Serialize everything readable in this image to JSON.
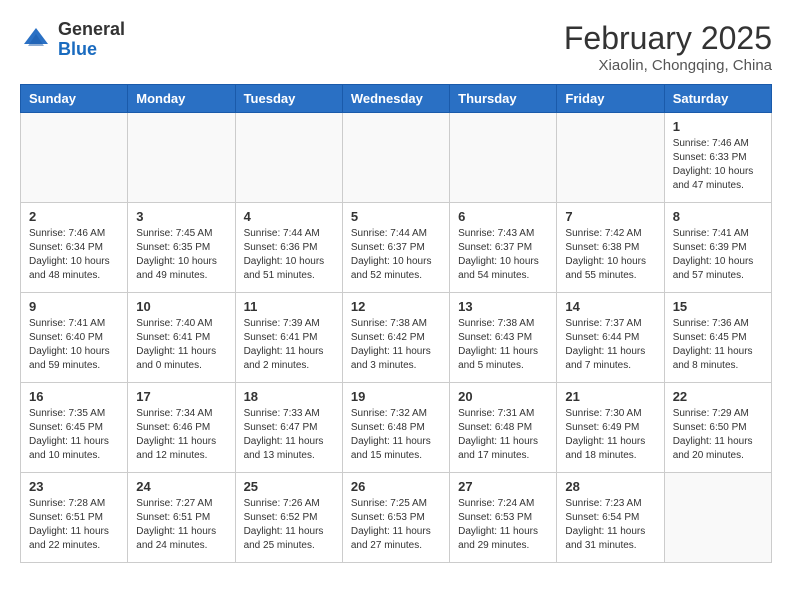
{
  "header": {
    "logo_general": "General",
    "logo_blue": "Blue",
    "month_title": "February 2025",
    "location": "Xiaolin, Chongqing, China"
  },
  "weekdays": [
    "Sunday",
    "Monday",
    "Tuesday",
    "Wednesday",
    "Thursday",
    "Friday",
    "Saturday"
  ],
  "weeks": [
    [
      {
        "day": "",
        "info": ""
      },
      {
        "day": "",
        "info": ""
      },
      {
        "day": "",
        "info": ""
      },
      {
        "day": "",
        "info": ""
      },
      {
        "day": "",
        "info": ""
      },
      {
        "day": "",
        "info": ""
      },
      {
        "day": "1",
        "info": "Sunrise: 7:46 AM\nSunset: 6:33 PM\nDaylight: 10 hours and 47 minutes."
      }
    ],
    [
      {
        "day": "2",
        "info": "Sunrise: 7:46 AM\nSunset: 6:34 PM\nDaylight: 10 hours and 48 minutes."
      },
      {
        "day": "3",
        "info": "Sunrise: 7:45 AM\nSunset: 6:35 PM\nDaylight: 10 hours and 49 minutes."
      },
      {
        "day": "4",
        "info": "Sunrise: 7:44 AM\nSunset: 6:36 PM\nDaylight: 10 hours and 51 minutes."
      },
      {
        "day": "5",
        "info": "Sunrise: 7:44 AM\nSunset: 6:37 PM\nDaylight: 10 hours and 52 minutes."
      },
      {
        "day": "6",
        "info": "Sunrise: 7:43 AM\nSunset: 6:37 PM\nDaylight: 10 hours and 54 minutes."
      },
      {
        "day": "7",
        "info": "Sunrise: 7:42 AM\nSunset: 6:38 PM\nDaylight: 10 hours and 55 minutes."
      },
      {
        "day": "8",
        "info": "Sunrise: 7:41 AM\nSunset: 6:39 PM\nDaylight: 10 hours and 57 minutes."
      }
    ],
    [
      {
        "day": "9",
        "info": "Sunrise: 7:41 AM\nSunset: 6:40 PM\nDaylight: 10 hours and 59 minutes."
      },
      {
        "day": "10",
        "info": "Sunrise: 7:40 AM\nSunset: 6:41 PM\nDaylight: 11 hours and 0 minutes."
      },
      {
        "day": "11",
        "info": "Sunrise: 7:39 AM\nSunset: 6:41 PM\nDaylight: 11 hours and 2 minutes."
      },
      {
        "day": "12",
        "info": "Sunrise: 7:38 AM\nSunset: 6:42 PM\nDaylight: 11 hours and 3 minutes."
      },
      {
        "day": "13",
        "info": "Sunrise: 7:38 AM\nSunset: 6:43 PM\nDaylight: 11 hours and 5 minutes."
      },
      {
        "day": "14",
        "info": "Sunrise: 7:37 AM\nSunset: 6:44 PM\nDaylight: 11 hours and 7 minutes."
      },
      {
        "day": "15",
        "info": "Sunrise: 7:36 AM\nSunset: 6:45 PM\nDaylight: 11 hours and 8 minutes."
      }
    ],
    [
      {
        "day": "16",
        "info": "Sunrise: 7:35 AM\nSunset: 6:45 PM\nDaylight: 11 hours and 10 minutes."
      },
      {
        "day": "17",
        "info": "Sunrise: 7:34 AM\nSunset: 6:46 PM\nDaylight: 11 hours and 12 minutes."
      },
      {
        "day": "18",
        "info": "Sunrise: 7:33 AM\nSunset: 6:47 PM\nDaylight: 11 hours and 13 minutes."
      },
      {
        "day": "19",
        "info": "Sunrise: 7:32 AM\nSunset: 6:48 PM\nDaylight: 11 hours and 15 minutes."
      },
      {
        "day": "20",
        "info": "Sunrise: 7:31 AM\nSunset: 6:48 PM\nDaylight: 11 hours and 17 minutes."
      },
      {
        "day": "21",
        "info": "Sunrise: 7:30 AM\nSunset: 6:49 PM\nDaylight: 11 hours and 18 minutes."
      },
      {
        "day": "22",
        "info": "Sunrise: 7:29 AM\nSunset: 6:50 PM\nDaylight: 11 hours and 20 minutes."
      }
    ],
    [
      {
        "day": "23",
        "info": "Sunrise: 7:28 AM\nSunset: 6:51 PM\nDaylight: 11 hours and 22 minutes."
      },
      {
        "day": "24",
        "info": "Sunrise: 7:27 AM\nSunset: 6:51 PM\nDaylight: 11 hours and 24 minutes."
      },
      {
        "day": "25",
        "info": "Sunrise: 7:26 AM\nSunset: 6:52 PM\nDaylight: 11 hours and 25 minutes."
      },
      {
        "day": "26",
        "info": "Sunrise: 7:25 AM\nSunset: 6:53 PM\nDaylight: 11 hours and 27 minutes."
      },
      {
        "day": "27",
        "info": "Sunrise: 7:24 AM\nSunset: 6:53 PM\nDaylight: 11 hours and 29 minutes."
      },
      {
        "day": "28",
        "info": "Sunrise: 7:23 AM\nSunset: 6:54 PM\nDaylight: 11 hours and 31 minutes."
      },
      {
        "day": "",
        "info": ""
      }
    ]
  ]
}
